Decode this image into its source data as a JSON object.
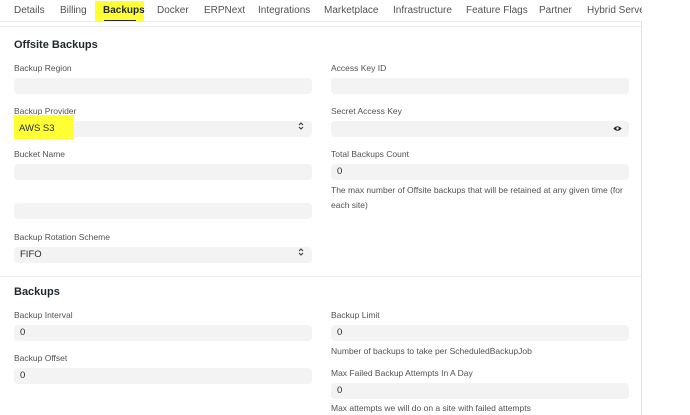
{
  "tabs": [
    "Details",
    "Billing",
    "Backups",
    "Docker",
    "ERPNext",
    "Integrations",
    "Marketplace",
    "Infrastructure",
    "Feature Flags",
    "Partner",
    "Hybrid Server"
  ],
  "active_tab": "Backups",
  "offsite": {
    "title": "Offsite Backups",
    "backup_region_label": "Backup Region",
    "backup_region_value": "",
    "access_key_label": "Access Key ID",
    "access_key_value": "",
    "backup_provider_label": "Backup Provider",
    "backup_provider_value": "AWS S3",
    "secret_key_label": "Secret Access Key",
    "secret_key_value": "",
    "bucket_name_label": "Bucket Name",
    "bucket_name_value": "",
    "total_count_label": "Total Backups Count",
    "total_count_value": "0",
    "total_count_desc": "The max number of Offsite backups that will be retained at any given time (for each site)",
    "extra_field_value": "",
    "rotation_label": "Backup Rotation Scheme",
    "rotation_value": "FIFO"
  },
  "backups": {
    "title": "Backups",
    "interval_label": "Backup Interval",
    "interval_value": "0",
    "limit_label": "Backup Limit",
    "limit_value": "0",
    "limit_desc": "Number of backups to take per ScheduledBackupJob",
    "offset_label": "Backup Offset",
    "offset_value": "0",
    "max_failed_label": "Max Failed Backup Attempts In A Day",
    "max_failed_value": "0",
    "max_failed_desc": "Max attempts we will do on a site with failed attempts"
  },
  "icons": {
    "select_chevron": "chevron-up-down-icon",
    "password_toggle": "eye-icon"
  },
  "colors": {
    "highlight": "#ffff33",
    "field_bg": "#f3f3f3",
    "text": "#1f272e",
    "muted": "#525252"
  }
}
